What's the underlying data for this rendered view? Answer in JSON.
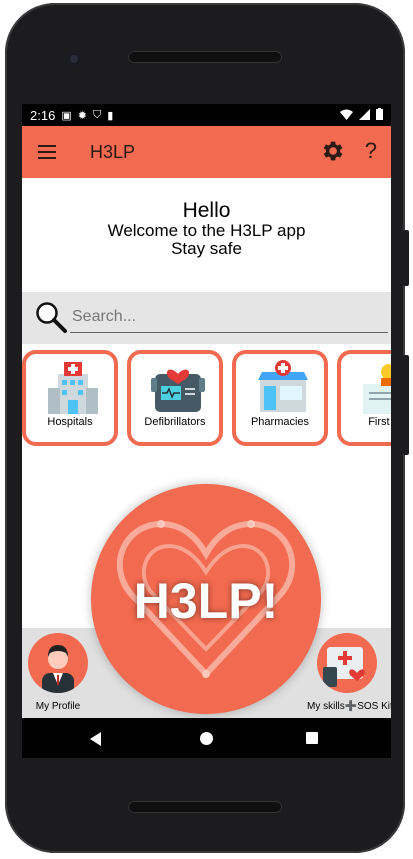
{
  "status": {
    "time": "2:16"
  },
  "app": {
    "title": "H3LP",
    "accent": "#f26a4f"
  },
  "icons": [
    "menu-icon",
    "gear-icon",
    "help-icon",
    "search-icon"
  ],
  "welcome": {
    "line1": "Hello",
    "line2": "Welcome to the H3LP app",
    "line3": "Stay safe"
  },
  "search": {
    "placeholder": "Search..."
  },
  "categories": [
    {
      "label": "Hospitals"
    },
    {
      "label": "Defibrillators"
    },
    {
      "label": "Pharmacies"
    },
    {
      "label": "First Ai"
    }
  ],
  "logo": {
    "text": "H3LP!"
  },
  "bottom": {
    "profile_label": "My Profile",
    "skills_label": "My skills➕SOS Kit"
  },
  "help_glyph": "?"
}
